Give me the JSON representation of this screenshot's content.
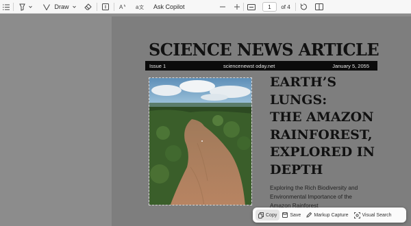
{
  "toolbar": {
    "draw_label": "Draw",
    "ask_copilot_label": "Ask Copilot",
    "page_number": "1",
    "page_total": "of 4"
  },
  "article": {
    "headline": "SCIENCE NEWS ARTICLE",
    "issue": "Issue 1",
    "website": "sciencenewst oday.net",
    "date": "January 5, 2055",
    "title_lines": [
      "EARTH’S",
      "LUNGS:",
      "THE AMAZON",
      "RAINFOREST,",
      "EXPLORED IN",
      "DEPTH"
    ],
    "subtitle_lines": [
      "Exploring the Rich Biodiversity and",
      "Environmental Importance of the",
      "Amazon Rainforest"
    ]
  },
  "image_actions": {
    "copy_label": "Copy",
    "save_label": "Save",
    "markup_label": "Markup Capture",
    "visual_search_label": "Visual Search"
  }
}
